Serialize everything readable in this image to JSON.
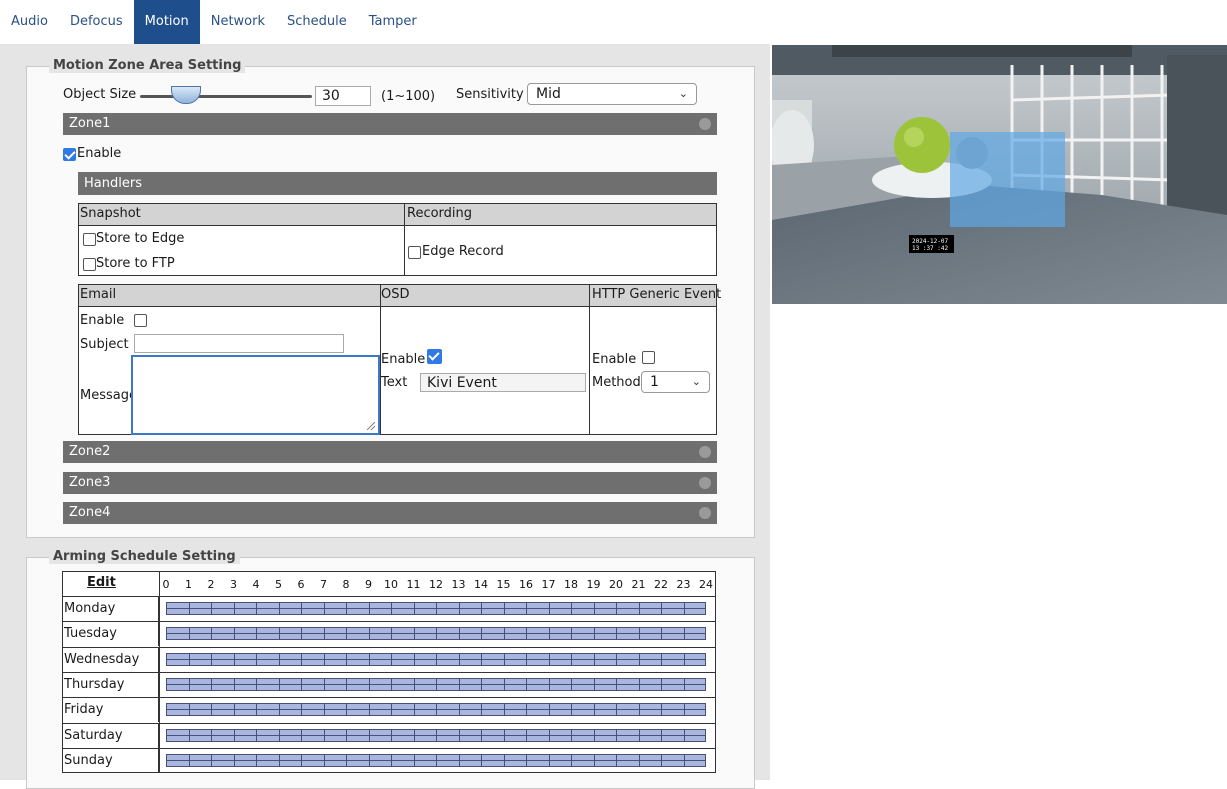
{
  "tabs": [
    {
      "label": "Audio",
      "active": false
    },
    {
      "label": "Defocus",
      "active": false
    },
    {
      "label": "Motion",
      "active": true
    },
    {
      "label": "Network",
      "active": false
    },
    {
      "label": "Schedule",
      "active": false
    },
    {
      "label": "Tamper",
      "active": false
    }
  ],
  "motion_zone": {
    "legend": "Motion Zone Area Setting",
    "object_size_label": "Object Size",
    "object_size_value": "30",
    "object_size_range": "(1~100)",
    "object_size_slider_level": 0.3,
    "sensitivity_label": "Sensitivity",
    "sensitivity_value": "Mid",
    "zone1": {
      "title": "Zone1",
      "enable_label": "Enable",
      "enabled": true,
      "handlers_title": "Handlers",
      "snapshot_header": "Snapshot",
      "store_edge_label": "Store to Edge",
      "store_ftp_label": "Store to FTP",
      "recording_header": "Recording",
      "edge_record_label": "Edge Record",
      "email_header": "Email",
      "email_enable_label": "Enable",
      "email_subject_label": "Subject",
      "email_message_label": "Message",
      "osd_header": "OSD",
      "osd_enable_label": "Enable",
      "osd_enabled": true,
      "osd_text_label": "Text",
      "osd_text_value": "Kivi Event",
      "http_header": "HTTP Generic Event",
      "http_enable_label": "Enable",
      "http_method_label": "Method",
      "http_method_value": "1"
    },
    "other_zones": [
      "Zone2",
      "Zone3",
      "Zone4"
    ]
  },
  "arming": {
    "legend": "Arming Schedule Setting",
    "edit_label": "Edit",
    "hours": [
      "0",
      "1",
      "2",
      "3",
      "4",
      "5",
      "6",
      "7",
      "8",
      "9",
      "10",
      "11",
      "12",
      "13",
      "14",
      "15",
      "16",
      "17",
      "18",
      "19",
      "20",
      "21",
      "22",
      "23",
      "24"
    ],
    "days": [
      "Monday",
      "Tuesday",
      "Wednesday",
      "Thursday",
      "Friday",
      "Saturday",
      "Sunday"
    ]
  },
  "camera": {
    "timestamp_line1": "2024-12-07",
    "timestamp_line2": "13 :37 :42"
  },
  "colors": {
    "tab_active": "#1f4e8c",
    "zone_bar": "#6f6f6f",
    "schedule_fill": "#a9b7e0",
    "motion_overlay": "#5fa8e6"
  }
}
